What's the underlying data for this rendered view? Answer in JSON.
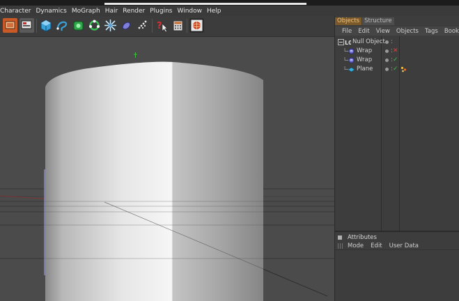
{
  "menu": {
    "items": [
      "Character",
      "Dynamics",
      "MoGraph",
      "Hair",
      "Render",
      "Plugins",
      "Window",
      "Help"
    ]
  },
  "toolbar": {
    "icons": [
      "render-region-icon",
      "render-view-icon",
      "cube-icon",
      "spline-icon",
      "nurbs-icon",
      "array-icon",
      "deformer-icon",
      "scene-icon",
      "light-icon",
      "particle-icon",
      "help-cursor-icon",
      "calculator-icon",
      "render-sphere-icon"
    ]
  },
  "viewport": {
    "nav_glyphs": "✥⬍⟲▢"
  },
  "object_manager": {
    "tabs": [
      {
        "label": "Objects",
        "active": true
      },
      {
        "label": "Structure",
        "active": false
      }
    ],
    "menu": [
      "File",
      "Edit",
      "View",
      "Objects",
      "Tags",
      "Bookm"
    ],
    "objects": [
      {
        "name": "Null Object",
        "icon": "null-object-icon",
        "flag": "",
        "flag_color": "#d8d8d8",
        "tag": ""
      },
      {
        "name": "Wrap",
        "icon": "wrap-deformer-icon",
        "flag": "✕",
        "flag_color": "#e04040",
        "tag": ""
      },
      {
        "name": "Wrap",
        "icon": "wrap-deformer-icon",
        "flag": "✓",
        "flag_color": "#40c040",
        "tag": ""
      },
      {
        "name": "Plane",
        "icon": "plane-icon",
        "flag": "✓",
        "flag_color": "#40c040",
        "tag": "texture-tag-icon"
      }
    ]
  },
  "attributes": {
    "title": "Attributes",
    "menu": [
      "Mode",
      "Edit",
      "User Data"
    ]
  },
  "colors": {
    "active_tab_bg": "#7a5a2a",
    "active_tab_text": "#f2c37a",
    "viewport_bg": "#4a4a4a",
    "panel_bg": "#3d3d3d"
  }
}
